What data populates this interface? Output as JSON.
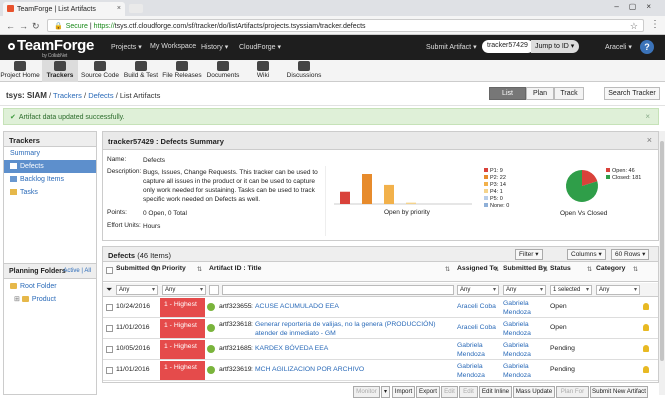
{
  "browser": {
    "tab_title": "TeamForge | List Artifacts",
    "url_scheme": "https://",
    "url_rest": "tsys.ctf.cloudforge.com/sf/tracker/do/listArtifacts/projects.tsyssiam/tracker.defects",
    "secure_label": "Secure"
  },
  "header": {
    "logo": "TeamForge",
    "logo_sub": "by CollabNet",
    "menus": [
      "Projects ▾",
      "My Workspace",
      "History ▾",
      "CloudForge ▾"
    ],
    "submit": "Submit Artifact ▾",
    "search_value": "tracker57429",
    "jump": "Jump to ID ▾",
    "user": "Araceli ▾",
    "help": "?"
  },
  "toolbar": [
    "Project Home",
    "Trackers",
    "Source Code",
    "Build & Test",
    "File Releases",
    "Documents",
    "Wiki",
    "Discussions"
  ],
  "breadcrumb": {
    "project": "tsys: SIAM",
    "sep": " / ",
    "trackers": "Trackers",
    "defects": "Defects",
    "current": "List Artifacts"
  },
  "views": [
    "List",
    "Plan",
    "Track"
  ],
  "search_tracker": "Search Tracker",
  "flash": "Artifact data updated successfully.",
  "sidebar": {
    "title": "Trackers",
    "items": [
      "Summary",
      "Defects",
      "Backlog Items",
      "Tasks"
    ],
    "planning_title": "Planning Folders",
    "planning_toggle": "Active | All",
    "folders": [
      "Root Folder",
      "Product"
    ]
  },
  "summary": {
    "title": "tracker57429 : Defects Summary",
    "name_k": "Name:",
    "name_v": "Defects",
    "desc_k": "Description:",
    "desc_v": "Bugs, Issues, Change Requests. This tracker can be used to capture all issues in the product or it can be used to capture only work needed for sustaining. Tasks can be used to track specific work needed on Defects as well.",
    "points_k": "Points:",
    "points_v": "0 Open, 0 Total",
    "effort_k": "Effort Units:",
    "effort_v": "Hours"
  },
  "chart_data": [
    {
      "type": "bar",
      "title": "Open by priority",
      "categories": [
        "P1",
        "P2",
        "P3",
        "P4",
        "P5",
        "None"
      ],
      "values": [
        9,
        22,
        14,
        1,
        0,
        0
      ],
      "legend": [
        "P1: 9",
        "P2: 22",
        "P3: 14",
        "P4: 1",
        "P5: 0",
        "None: 0"
      ],
      "colors": [
        "#d9423a",
        "#e78b2c",
        "#f2b14b",
        "#f4d38c",
        "#b8cde8",
        "#8fb0d8"
      ]
    },
    {
      "type": "pie",
      "title": "Open Vs Closed",
      "categories": [
        "Open",
        "Closed"
      ],
      "values": [
        46,
        181
      ],
      "legend": [
        "Open: 46",
        "Closed: 181"
      ],
      "colors": [
        "#d9423a",
        "#2f9e49"
      ]
    }
  ],
  "grid": {
    "title": "Defects",
    "count": "(46 Items)",
    "filter_btn": "Filter ▾",
    "columns_btn": "Columns ▾",
    "rows_btn": "60 Rows ▾",
    "headers": [
      "Submitted On",
      "Priority",
      "Artifact ID : Title",
      "Assigned To",
      "Submitted By",
      "Status",
      "Category"
    ],
    "filters": [
      "Any",
      "Any",
      "",
      "Any",
      "Any",
      "1 selected",
      "Any"
    ],
    "rows": [
      {
        "date": "10/24/2016",
        "priority": "1 - Highest",
        "id": "artf323655",
        "title": "ACUSE ACUMULADO EEA",
        "assigned": "Araceli Coba",
        "submitted": "Gabriela Mendoza",
        "status": "Open"
      },
      {
        "date": "11/01/2016",
        "priority": "1 - Highest",
        "id": "artf323618",
        "title": "Generar reporteria de valijas, no la genera (PRODUCCIÓN) atender de inmediato - GM",
        "assigned": "Araceli Coba",
        "submitted": "Gabriela Mendoza",
        "status": "Open"
      },
      {
        "date": "10/05/2016",
        "priority": "1 - Highest",
        "id": "artf321685",
        "title": "KARDEX BÓVEDA EEA",
        "assigned": "Gabriela Mendoza",
        "submitted": "Gabriela Mendoza",
        "status": "Pending"
      },
      {
        "date": "11/01/2016",
        "priority": "1 - Highest",
        "id": "artf323619",
        "title": "MCH AGILIZACION POR ARCHIVO",
        "assigned": "Gabriela Mendoza",
        "submitted": "Gabriela Mendoza",
        "status": "Pending"
      }
    ]
  },
  "actions": [
    "Monitor",
    "▾",
    "Import",
    "Export",
    "Edit",
    "Edit",
    "Edit Inline",
    "Mass Update",
    "Plan For",
    "Submit New Artifact"
  ]
}
